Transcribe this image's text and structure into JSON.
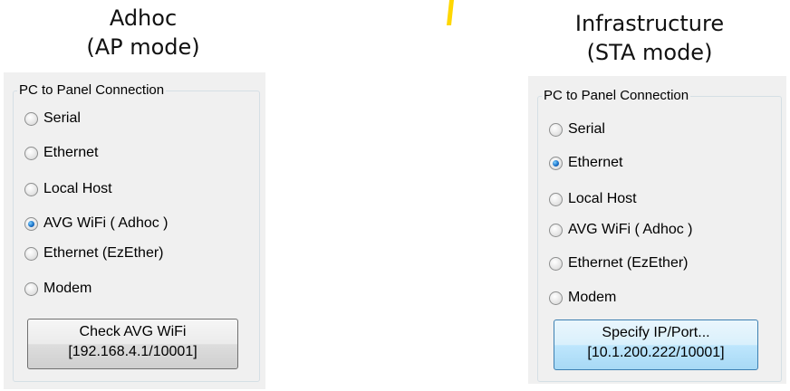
{
  "left": {
    "caption_line1": "Adhoc",
    "caption_line2": "(AP mode)",
    "group_title": "PC to Panel Connection",
    "options": [
      {
        "label": "Serial",
        "checked": false
      },
      {
        "label": "Ethernet",
        "checked": false
      },
      {
        "label": "Local Host",
        "checked": false
      },
      {
        "label": "AVG WiFi ( Adhoc )",
        "checked": true
      },
      {
        "label": "Ethernet (EzEther)",
        "checked": false
      },
      {
        "label": "Modem",
        "checked": false
      }
    ],
    "button_line1": "Check AVG WiFi",
    "button_line2": "[192.168.4.1/10001]"
  },
  "right": {
    "caption_line1": "Infrastructure",
    "caption_line2": "(STA mode)",
    "group_title": "PC to Panel Connection",
    "options": [
      {
        "label": "Serial",
        "checked": false
      },
      {
        "label": "Ethernet",
        "checked": true
      },
      {
        "label": "Local Host",
        "checked": false
      },
      {
        "label": "AVG WiFi ( Adhoc )",
        "checked": false
      },
      {
        "label": "Ethernet (EzEther)",
        "checked": false
      },
      {
        "label": "Modem",
        "checked": false
      }
    ],
    "button_line1": "Specify IP/Port...",
    "button_line2": "[10.1.200.222/10001]"
  },
  "colors": {
    "accent_mark": "#ffd700",
    "panel_bg": "#f0f0f0",
    "radio_selected": "#1b73c9",
    "hover_button_border": "#3c7fb1"
  }
}
